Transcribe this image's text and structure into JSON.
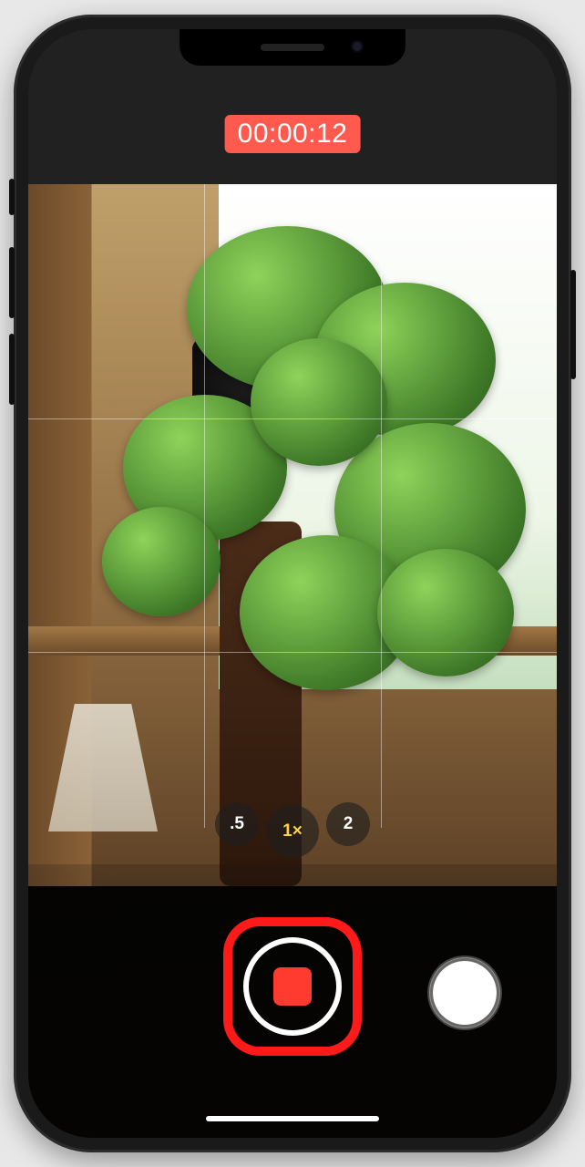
{
  "recording": {
    "timer": "00:00:12",
    "timer_bg": "#ff5a4d"
  },
  "zoom": {
    "options": [
      ".5",
      "1×",
      "2"
    ],
    "active_index": 1
  },
  "controls": {
    "stop_name": "stop-recording-button",
    "still_name": "capture-still-button"
  },
  "highlight": {
    "color": "#ff1a1a"
  }
}
